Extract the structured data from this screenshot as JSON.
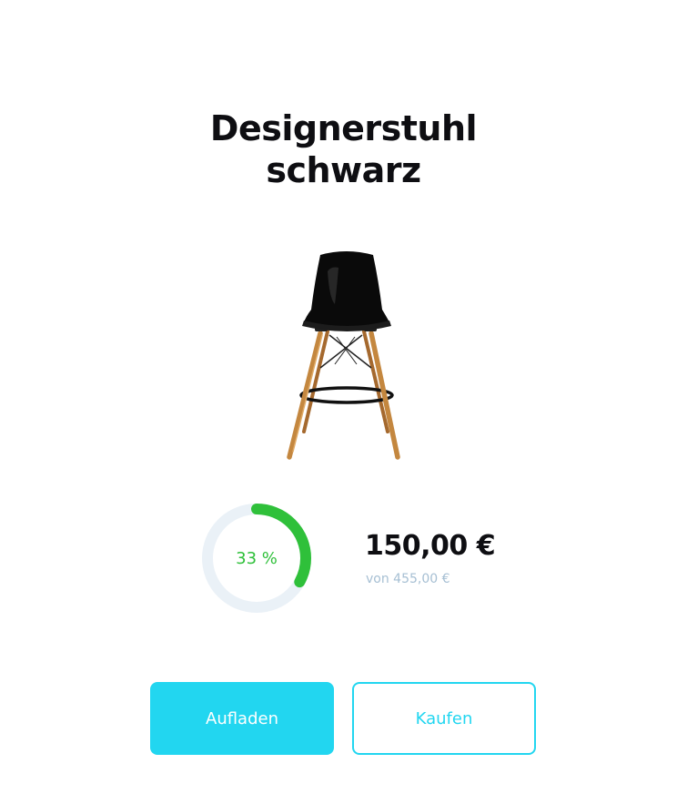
{
  "product": {
    "title_line1": "Designerstuhl",
    "title_line2": "schwarz",
    "image_icon": "chair-image"
  },
  "progress": {
    "percent_label": "33 %",
    "value": 0.33,
    "track_color": "#eaf1f7",
    "fill_color": "#2fc03a"
  },
  "price": {
    "current": "150,00 €",
    "total": "von 455,00 €"
  },
  "actions": {
    "charge_label": "Aufladen",
    "buy_label": "Kaufen",
    "accent_color": "#22d6f0"
  }
}
